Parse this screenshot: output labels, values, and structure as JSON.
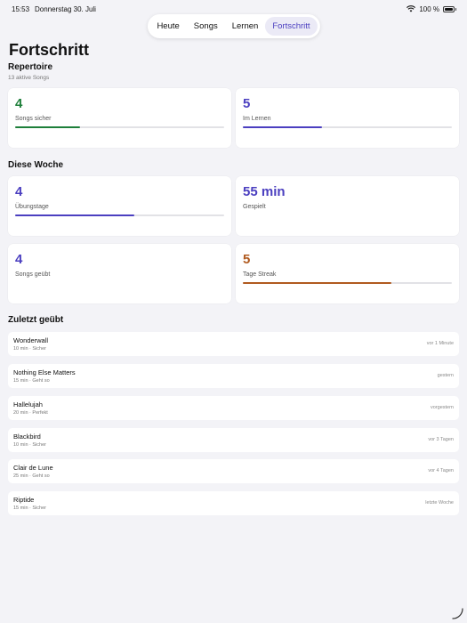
{
  "status_bar": {
    "time": "15:53",
    "date": "Donnerstag 30. Juli",
    "battery": "100 %"
  },
  "tabs": [
    {
      "label": "Heute",
      "active": false
    },
    {
      "label": "Songs",
      "active": false
    },
    {
      "label": "Lernen",
      "active": false
    },
    {
      "label": "Fortschritt",
      "active": true
    }
  ],
  "page_title": "Fortschritt",
  "repertoire": {
    "title": "Repertoire",
    "subtitle": "13 aktive Songs",
    "cards": [
      {
        "value": "4",
        "label": "Songs sicher",
        "color": "#1e7f3a",
        "progress": 0.31
      },
      {
        "value": "5",
        "label": "Im Lernen",
        "color": "#4b3fc0",
        "progress": 0.38
      }
    ]
  },
  "week": {
    "title": "Diese Woche",
    "cards": [
      {
        "value": "4",
        "label": "Übungstage",
        "color": "#4b3fc0",
        "progress": 0.57
      },
      {
        "value": "55 min",
        "label": "Gespielt",
        "color": "#4b3fc0"
      },
      {
        "value": "4",
        "label": "Songs geübt",
        "color": "#4b3fc0"
      },
      {
        "value": "5",
        "label": "Tage Streak",
        "color": "#b05a1f",
        "progress": 0.71
      }
    ]
  },
  "recent": {
    "title": "Zuletzt geübt",
    "items": [
      {
        "title": "Wonderwall",
        "meta": "10 min · Sicher",
        "when": "vor 1 Minute"
      },
      {
        "title": "Nothing Else Matters",
        "meta": "15 min · Geht so",
        "when": "gestern"
      },
      {
        "title": "Hallelujah",
        "meta": "20 min · Perfekt",
        "when": "vorgestern"
      },
      {
        "title": "Blackbird",
        "meta": "10 min · Sicher",
        "when": "vor 3 Tagen"
      },
      {
        "title": "Clair de Lune",
        "meta": "25 min · Geht so",
        "when": "vor 4 Tagen"
      },
      {
        "title": "Riptide",
        "meta": "15 min · Sicher",
        "when": "letzte Woche"
      }
    ]
  }
}
